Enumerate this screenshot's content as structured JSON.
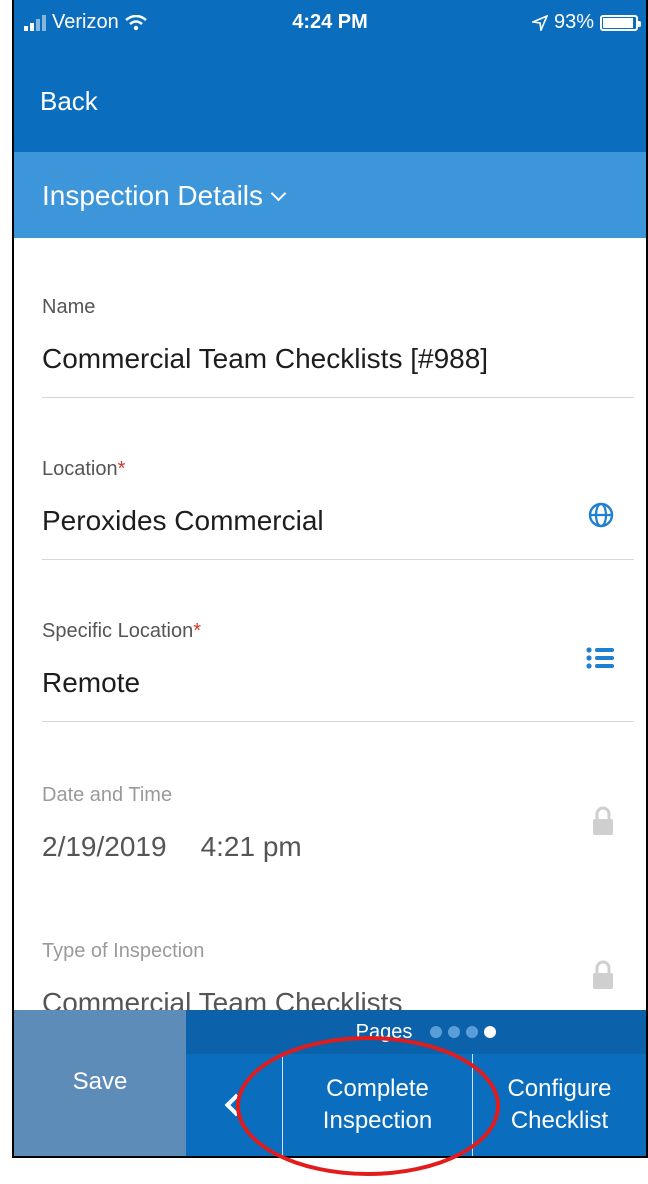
{
  "status_bar": {
    "carrier": "Verizon",
    "time": "4:24 PM",
    "battery": "93%",
    "battery_level": 0.93
  },
  "nav": {
    "back_label": "Back"
  },
  "section": {
    "title": "Inspection Details"
  },
  "fields": {
    "name": {
      "label": "Name",
      "value": "Commercial Team Checklists [#988]"
    },
    "location": {
      "label": "Location",
      "required_mark": "*",
      "value": "Peroxides Commercial",
      "icon": "globe-icon"
    },
    "specific_location": {
      "label": "Specific Location",
      "required_mark": "*",
      "value": "Remote",
      "icon": "list-icon"
    },
    "date_time": {
      "label": "Date and Time",
      "date": "2/19/2019",
      "time": "4:21 pm",
      "icon": "lock-icon"
    },
    "type": {
      "label": "Type of Inspection",
      "value": "Commercial Team Checklists",
      "icon": "lock-icon"
    }
  },
  "bottom": {
    "save_label": "Save",
    "pages_label": "Pages",
    "page_count": 4,
    "current_page": 4,
    "complete_line1": "Complete",
    "complete_line2": "Inspection",
    "configure_line1": "Configure",
    "configure_line2": "Checklist"
  },
  "colors": {
    "nav": "#0b6dbd",
    "section": "#3d96d9",
    "save": "#5e8cb8",
    "required": "#d9342b",
    "annotation": "#e31b1b"
  }
}
